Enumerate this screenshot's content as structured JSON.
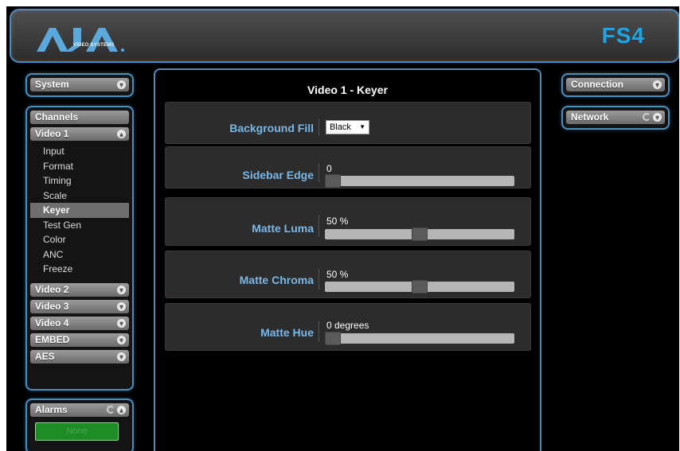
{
  "header": {
    "logo_text": "AJA",
    "logo_sub": "VIDEO SYSTEMS",
    "product": "FS4"
  },
  "left_nav": {
    "system_label": "System",
    "channels_label": "Channels",
    "video1_label": "Video 1",
    "video1_items": [
      {
        "label": "Input"
      },
      {
        "label": "Format"
      },
      {
        "label": "Timing"
      },
      {
        "label": "Scale"
      },
      {
        "label": "Keyer",
        "active": true
      },
      {
        "label": "Test Gen"
      },
      {
        "label": "Color"
      },
      {
        "label": "ANC"
      },
      {
        "label": "Freeze"
      }
    ],
    "video2_label": "Video 2",
    "video3_label": "Video 3",
    "video4_label": "Video 4",
    "embed_label": "EMBED",
    "aes_label": "AES",
    "alarms_label": "Alarms",
    "alarm_status": "None"
  },
  "right_nav": {
    "connection_label": "Connection",
    "network_label": "Network"
  },
  "main": {
    "title": "Video 1 - Keyer",
    "background_fill": {
      "label": "Background Fill",
      "value": "Black"
    },
    "sidebar_edge": {
      "label": "Sidebar Edge",
      "value_text": "0",
      "fraction": 0.0
    },
    "matte_luma": {
      "label": "Matte Luma",
      "value_text": "50 %",
      "fraction": 0.5
    },
    "matte_chroma": {
      "label": "Matte Chroma",
      "value_text": "50 %",
      "fraction": 0.5
    },
    "matte_hue": {
      "label": "Matte Hue",
      "value_text": "0 degrees",
      "fraction": 0.0
    }
  },
  "colors": {
    "accent_border": "#4a8ec0",
    "label_blue": "#79b7e6",
    "product_blue": "#1ba6e6",
    "alarm_green": "#1e8c24"
  }
}
